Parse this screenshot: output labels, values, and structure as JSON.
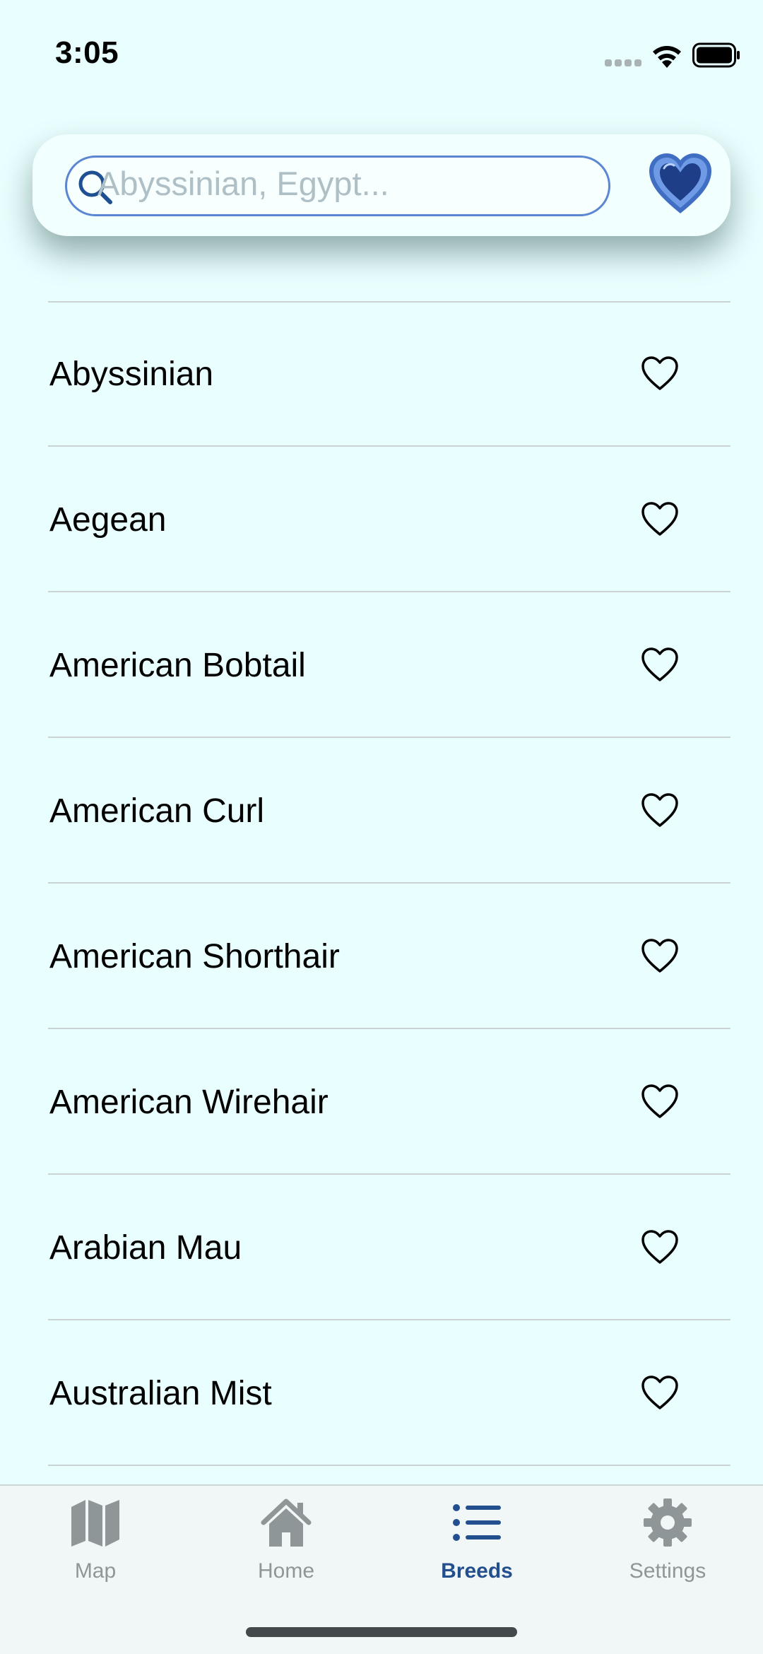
{
  "status_bar": {
    "time": "3:05",
    "icons": [
      "cellular-signal-icon",
      "wifi-icon",
      "battery-icon"
    ]
  },
  "search": {
    "placeholder": "Abyssinian, Egypt...",
    "value": "",
    "icon": "search-icon",
    "favorites_icon": "heart-filled-icon"
  },
  "breeds": [
    {
      "name": "Abyssinian",
      "favorite": false
    },
    {
      "name": "Aegean",
      "favorite": false
    },
    {
      "name": "American Bobtail",
      "favorite": false
    },
    {
      "name": "American Curl",
      "favorite": false
    },
    {
      "name": "American Shorthair",
      "favorite": false
    },
    {
      "name": "American Wirehair",
      "favorite": false
    },
    {
      "name": "Arabian Mau",
      "favorite": false
    },
    {
      "name": "Australian Mist",
      "favorite": false
    }
  ],
  "tabs": [
    {
      "label": "Map",
      "icon": "map-icon",
      "active": false
    },
    {
      "label": "Home",
      "icon": "house-icon",
      "active": false
    },
    {
      "label": "Breeds",
      "icon": "list-icon",
      "active": true
    },
    {
      "label": "Settings",
      "icon": "gear-icon",
      "active": false
    }
  ],
  "colors": {
    "background": "#e9fefe",
    "accent": "#234f8f",
    "search_border": "#5b86d2",
    "inactive_tab": "#8e9697"
  }
}
